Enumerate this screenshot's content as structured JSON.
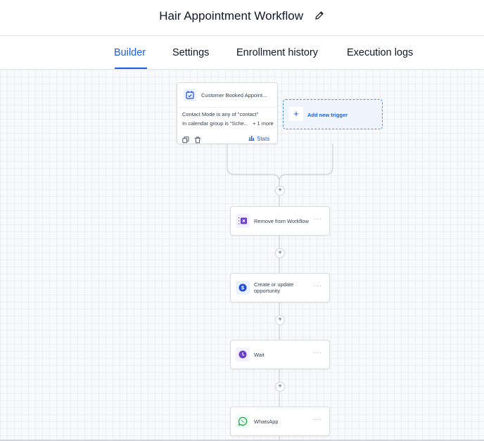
{
  "header": {
    "title": "Hair Appointment Workflow",
    "edit_icon": "pencil-icon"
  },
  "tabs": [
    {
      "label": "Builder",
      "active": true
    },
    {
      "label": "Settings",
      "active": false
    },
    {
      "label": "Enrollment history",
      "active": false
    },
    {
      "label": "Execution logs",
      "active": false
    }
  ],
  "trigger": {
    "icon": "calendar-check-icon",
    "name": "Customer Booked Appoint...",
    "conditions": [
      "Contact Mode is any of \"contact\"",
      "In calendar group is \"Sche..."
    ],
    "more": "+ 1 more",
    "stats_label": "Stats"
  },
  "add_trigger": {
    "label": "Add new trigger"
  },
  "actions": [
    {
      "label": "Remove from Workflow",
      "icon": "remove-workflow-icon"
    },
    {
      "label": "Create or update opportunity",
      "icon": "dollar-icon"
    },
    {
      "label": "Wait",
      "icon": "clock-icon"
    },
    {
      "label": "WhatsApp",
      "icon": "whatsapp-icon"
    }
  ],
  "colors": {
    "accent": "#155eef",
    "purple": "#6941c6",
    "green": "#16a34a"
  }
}
